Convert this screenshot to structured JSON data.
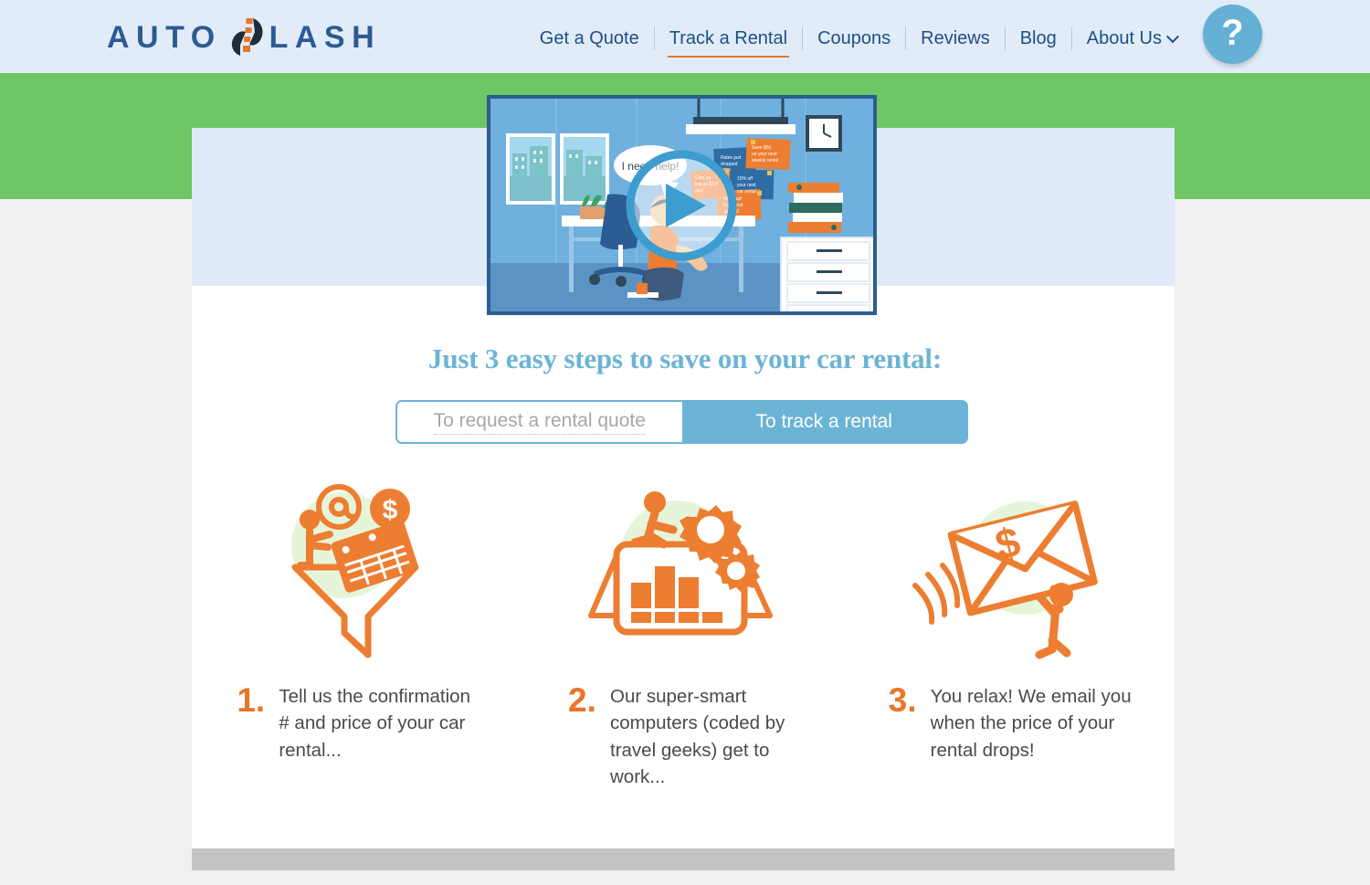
{
  "header": {
    "logo": {
      "text_left": "AUTO",
      "text_right": "LASH",
      "mark": "road-slash-mark"
    },
    "nav": [
      {
        "label": "Get a Quote",
        "active": false
      },
      {
        "label": "Track a Rental",
        "active": true
      },
      {
        "label": "Coupons",
        "active": false
      },
      {
        "label": "Reviews",
        "active": false
      },
      {
        "label": "Blog",
        "active": false
      },
      {
        "label": "About Us",
        "active": false,
        "has_dropdown": true
      }
    ],
    "help_button_label": "?",
    "colors": {
      "header_bg": "#e2ecf9",
      "nav_text": "#1d4f86",
      "active_underline": "#e8762a",
      "help_bg": "#63b0d4"
    }
  },
  "banner": {
    "green_band_color": "#6ec664",
    "card_top_color": "#e0e9f7",
    "card_bg": "#ffffff",
    "bottom_bar_color": "#c4c4c4"
  },
  "video": {
    "name": "explainer-video-thumbnail",
    "play_label": "Play",
    "speech_bubble": "I need help!",
    "sticky_notes": [
      "Rates just dropped 10%!",
      "Save $50 on your next weekly rental",
      "Cars as low as $10/day!",
      "15% off your next car rental",
      "Hurry up! Early bird special!"
    ]
  },
  "main": {
    "heading": "Just 3 easy steps to save on your car rental:",
    "heading_color": "#6cb4d6",
    "toggle": {
      "options": [
        {
          "label": "To request a rental quote",
          "active": false
        },
        {
          "label": "To track a rental",
          "active": true
        }
      ],
      "active_color": "#6cb4d6"
    },
    "steps": [
      {
        "number": "1.",
        "text": "Tell us the confirmation # and price of your car rental...",
        "icon": "funnel-with-forms-icon"
      },
      {
        "number": "2.",
        "text": "Our super-smart computers (coded by travel geeks) get to work...",
        "icon": "laptop-gears-chart-icon"
      },
      {
        "number": "3.",
        "text": "You relax! We email you when the price of your rental drops!",
        "icon": "flying-money-envelope-icon"
      }
    ],
    "step_number_color": "#e8762a",
    "icon_color": "#ed7d31",
    "icon_halo_color": "#e6f5d9"
  }
}
